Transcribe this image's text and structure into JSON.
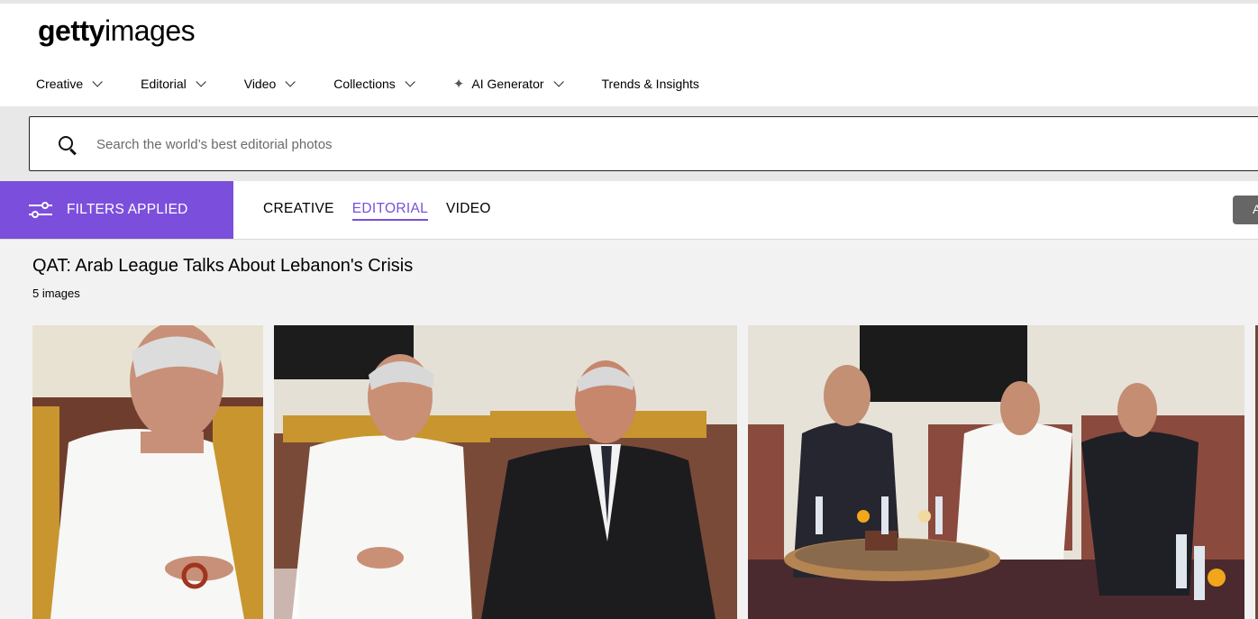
{
  "logo": {
    "bold": "getty",
    "light": "images"
  },
  "nav": {
    "creative": "Creative",
    "editorial": "Editorial",
    "video": "Video",
    "collections": "Collections",
    "ai_generator": "AI Generator",
    "trends": "Trends & Insights"
  },
  "search": {
    "placeholder": "Search the world’s best editorial photos"
  },
  "filters": {
    "label": "FILTERS APPLIED",
    "tabs": [
      "CREATIVE",
      "EDITORIAL",
      "VIDEO"
    ],
    "active_tab": "EDITORIAL",
    "right_button_text": "A"
  },
  "event": {
    "title": "QAT: Arab League Talks About Lebanon's Crisis",
    "count": "5 images"
  },
  "colors": {
    "accent": "#7b4fdc"
  }
}
